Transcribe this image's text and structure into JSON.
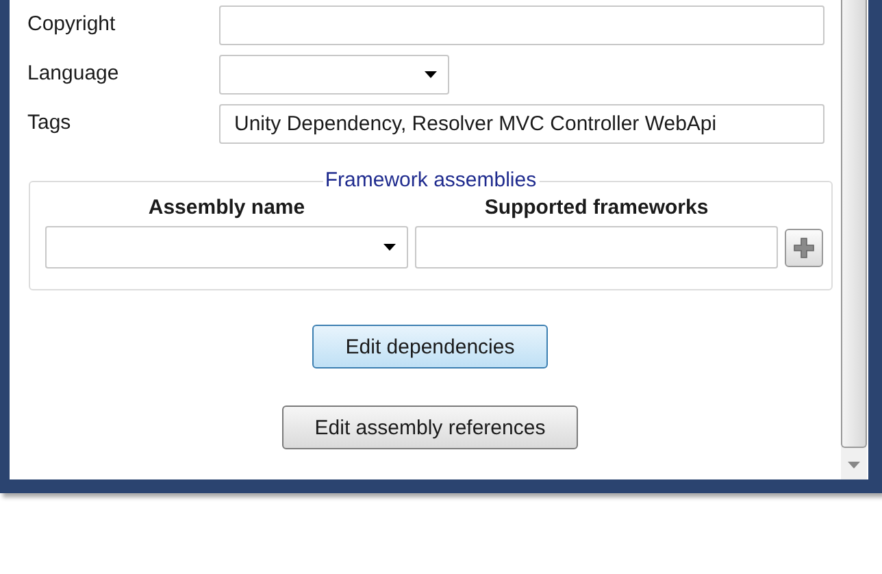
{
  "fields": [
    {
      "label": "Copyright",
      "kind": "text"
    },
    {
      "label": "Language",
      "kind": "dropdown"
    },
    {
      "label": "Tags",
      "kind": "text",
      "value": "Unity Dependency, Resolver MVC Controller WebApi"
    }
  ],
  "framework_assemblies": {
    "title": "Framework assemblies",
    "columns": [
      "Assembly name",
      "Supported frameworks"
    ]
  },
  "buttons": [
    {
      "label": "Edit dependencies",
      "focused": true
    },
    {
      "label": "Edit assembly references",
      "focused": false
    }
  ]
}
